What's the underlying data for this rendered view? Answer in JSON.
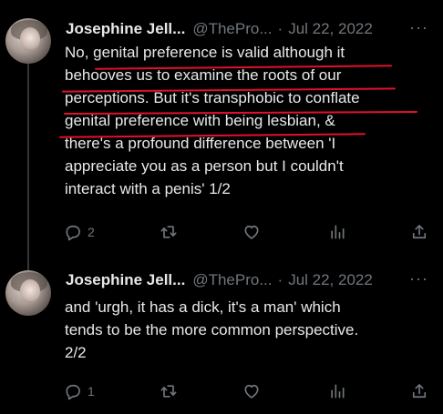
{
  "tweets": [
    {
      "author_name": "Josephine Jell...",
      "handle": "@ThePro...",
      "separator": "·",
      "date": "Jul 22, 2022",
      "more_label": "···",
      "lines": [
        "No, genital preference is valid although it",
        "behooves us to examine the roots of our",
        "perceptions. But it's transphobic to conflate",
        "genital preference with being lesbian, &",
        "there's a profound difference between 'I",
        "appreciate you as a person but I couldn't",
        "interact with a penis' 1/2"
      ],
      "reply_count": "2",
      "retweet_count": "",
      "like_count": "",
      "view_count": ""
    },
    {
      "author_name": "Josephine Jell...",
      "handle": "@ThePro...",
      "separator": "·",
      "date": "Jul 22, 2022",
      "more_label": "···",
      "lines": [
        "and 'urgh, it has a dick, it's a man' which",
        "tends to be the more common perspective.",
        "2/2"
      ],
      "reply_count": "1",
      "retweet_count": "",
      "like_count": "",
      "view_count": ""
    }
  ],
  "colors": {
    "background": "#000000",
    "text_primary": "#e7e9ea",
    "text_secondary": "#71767b",
    "annotation_underline": "#e0112b"
  },
  "icons": [
    "reply-icon",
    "retweet-icon",
    "like-icon",
    "views-icon",
    "share-icon",
    "more-icon"
  ]
}
